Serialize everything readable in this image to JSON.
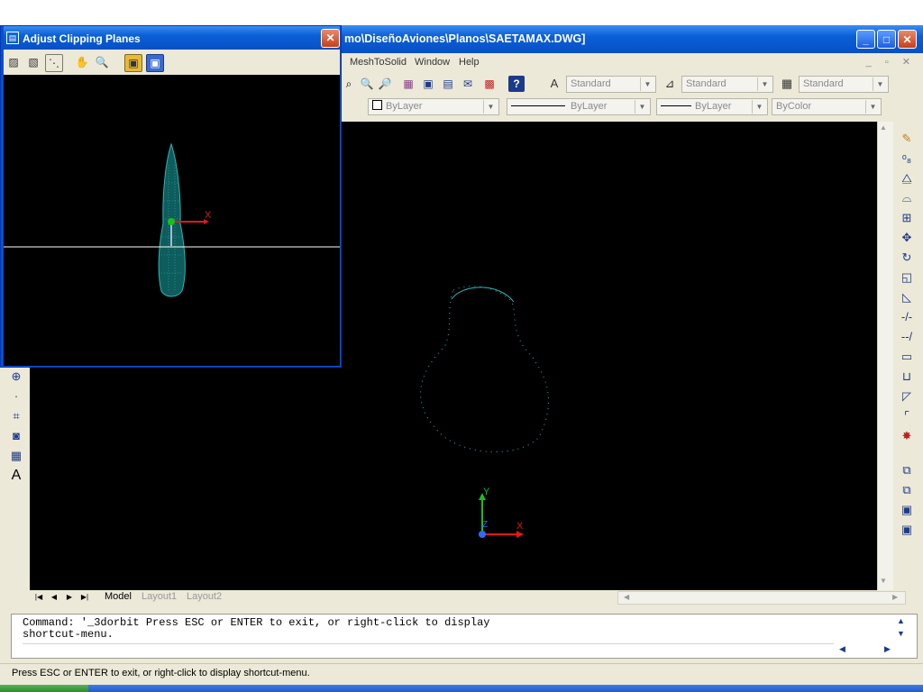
{
  "window": {
    "title": "mo\\DiseñoAviones\\Planos\\SAETAMAX.DWG]",
    "controls": {
      "minimize": "_",
      "maximize": "□",
      "close": "✕"
    }
  },
  "menu": {
    "items": [
      "MeshToSolid",
      "Window",
      "Help"
    ]
  },
  "toolbar": {
    "text_style": "Standard",
    "dim_style": "Standard",
    "table_style": "Standard",
    "layer": "ByLayer",
    "linetype": "ByLayer",
    "lineweight": "ByLayer",
    "plotstyle": "ByColor"
  },
  "tabs": {
    "model": "Model",
    "layout1": "Layout1",
    "layout2": "Layout2"
  },
  "command": {
    "line1": "Command: '_3dorbit Press ESC or ENTER to exit, or right-click to display",
    "line2": "shortcut-menu."
  },
  "status": {
    "text": "Press ESC or ENTER to exit, or right-click to display shortcut-menu."
  },
  "dialog": {
    "title": "Adjust Clipping Planes",
    "close": "✕"
  },
  "ucs": {
    "x": "X",
    "y": "Y",
    "z": "Z"
  },
  "colors": {
    "title_blue": "#0a5fd8",
    "model_cyan": "#2fb5b5",
    "axis_red": "#e01818",
    "axis_green": "#18c018",
    "axis_blue": "#2b6cff"
  },
  "icons": {
    "dialog_toolbar": [
      "adjust-front-clip-icon",
      "adjust-back-clip-icon",
      "create-slice-icon",
      "pan-icon",
      "zoom-icon",
      "front-clipping-toggle-icon",
      "back-clipping-toggle-icon"
    ],
    "modify_toolbar": [
      "erase-icon",
      "copy-icon",
      "mirror-icon",
      "offset-icon",
      "array-icon",
      "move-icon",
      "rotate-icon",
      "scale-icon",
      "stretch-icon",
      "trim-icon",
      "extend-icon",
      "break-icon",
      "join-icon",
      "chamfer-icon",
      "fillet-icon",
      "explode-icon"
    ],
    "draw_toolbar": [
      "insert-block-icon",
      "point-icon",
      "hatch-icon",
      "region-icon",
      "table-icon",
      "mtext-icon"
    ]
  }
}
